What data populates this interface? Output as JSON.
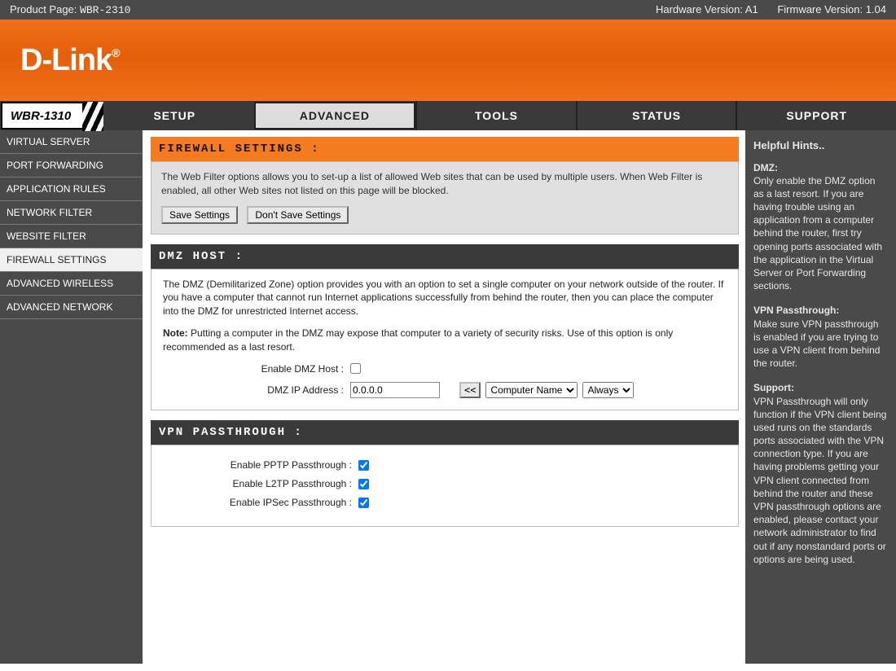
{
  "topbar": {
    "product_page_label": "Product Page:",
    "product_page_value": "WBR-2310",
    "hw_label": "Hardware Version: A1",
    "fw_label": "Firmware Version: 1.04"
  },
  "logo": {
    "text": "D-Link"
  },
  "model_label": "WBR-1310",
  "tabs": {
    "setup": "SETUP",
    "advanced": "ADVANCED",
    "tools": "TOOLS",
    "status": "STATUS",
    "support": "SUPPORT"
  },
  "leftnav": [
    "VIRTUAL SERVER",
    "PORT FORWARDING",
    "APPLICATION RULES",
    "NETWORK FILTER",
    "WEBSITE FILTER",
    "FIREWALL SETTINGS",
    "ADVANCED WIRELESS",
    "ADVANCED NETWORK"
  ],
  "firewall": {
    "heading": "FIREWALL SETTINGS :",
    "desc": "The Web Filter options allows you to set-up a list of allowed Web sites that can be used by multiple users. When Web Filter is enabled, all other Web sites not listed on this page will be blocked.",
    "save": "Save Settings",
    "dont_save": "Don't Save Settings"
  },
  "dmz": {
    "heading": "DMZ HOST :",
    "desc": "The DMZ (Demilitarized Zone) option provides you with an option to set a single computer on your network outside of the router. If you have a computer that cannot run Internet applications successfully from behind the router, then you can place the computer into the DMZ for unrestricted Internet access.",
    "note_label": "Note:",
    "note_text": " Putting a computer in the DMZ may expose that computer to a variety of security risks. Use of this option is only recommended as a last resort.",
    "enable_label": "Enable DMZ Host :",
    "ip_label": "DMZ IP Address :",
    "ip_value": "0.0.0.0",
    "lshift": "<<",
    "computer_name": "Computer Name",
    "always": "Always"
  },
  "vpn": {
    "heading": "VPN PASSTHROUGH :",
    "pptp": "Enable PPTP Passthrough :",
    "l2tp": "Enable L2TP Passthrough :",
    "ipsec": "Enable IPSec Passthrough :"
  },
  "hints": {
    "title": "Helpful Hints..",
    "dmz_h": "DMZ:",
    "dmz_t": "Only enable the DMZ option as a last resort. If you are having trouble using an application from a computer behind the router, first try opening ports associated with the application in the Virtual Server or Port Forwarding sections.",
    "vpn_h": "VPN Passthrough:",
    "vpn_t": "Make sure VPN passthrough is enabled if you are trying to use a VPN client from behind the router.",
    "sup_h": "Support:",
    "sup_t": "VPN Passthrough will only function if the VPN client being used runs on the standards ports associated with the VPN connection type. If you are having problems getting your VPN client connected from behind the router and these VPN passthrough options are enabled, please contact your network administrator to find out if any nonstandard ports or options are being used."
  }
}
